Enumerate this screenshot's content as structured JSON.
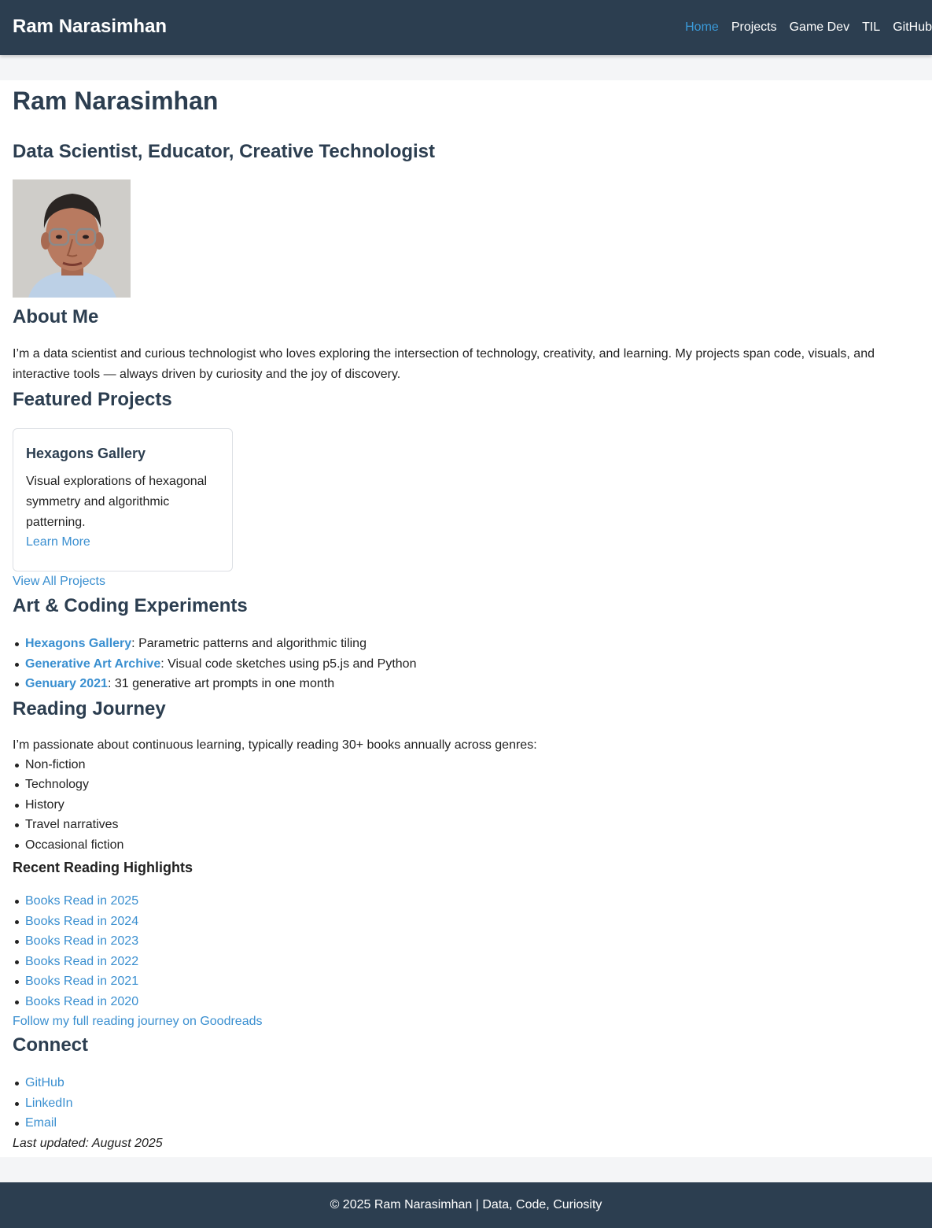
{
  "header": {
    "brand": "Ram Narasimhan",
    "nav": [
      {
        "label": "Home",
        "active": true
      },
      {
        "label": "Projects"
      },
      {
        "label": "Game Dev"
      },
      {
        "label": "TIL"
      },
      {
        "label": "GitHub"
      }
    ]
  },
  "main": {
    "title": "Ram Narasimhan",
    "subtitle": "Data Scientist, Educator, Creative Technologist",
    "about": {
      "heading": "About Me",
      "text": "I’m a data scientist and curious technologist who loves exploring the intersection of technology, creativity, and learning. My projects span code, visuals, and interactive tools — always driven by curiosity and the joy of discovery."
    },
    "featured": {
      "heading": "Featured Projects",
      "card": {
        "title": "Hexagons Gallery",
        "description": "Visual explorations of hexagonal symmetry and algorithmic patterning.",
        "link": "Learn More"
      },
      "view_all": "View All Projects"
    },
    "art": {
      "heading": "Art & Coding Experiments",
      "items": [
        {
          "link": "Hexagons Gallery",
          "text": ": Parametric patterns and algorithmic tiling"
        },
        {
          "link": "Generative Art Archive",
          "text": ": Visual code sketches using p5.js and Python"
        },
        {
          "link": "Genuary 2021",
          "text": ": 31 generative art prompts in one month"
        }
      ]
    },
    "reading": {
      "heading": "Reading Journey",
      "text": "I’m passionate about continuous learning, typically reading 30+ books annually across genres:",
      "genres": [
        "Non-fiction",
        "Technology",
        "History",
        "Travel narratives",
        "Occasional fiction"
      ],
      "highlights_heading": "Recent Reading Highlights",
      "books": [
        "Books Read in 2025",
        "Books Read in 2024",
        "Books Read in 2023",
        "Books Read in 2022",
        "Books Read in 2021",
        "Books Read in 2020"
      ],
      "goodreads": "Follow my full reading journey on Goodreads"
    },
    "connect": {
      "heading": "Connect",
      "links": [
        "GitHub",
        "LinkedIn",
        "Email"
      ]
    },
    "updated": "Last updated: August 2025"
  },
  "footer": {
    "text": "© 2025 Ram Narasimhan | Data, Code, Curiosity"
  },
  "colors": {
    "header_bg": "#2c3e50",
    "link": "#3a8fd0",
    "active_nav": "#3a9ad9"
  }
}
